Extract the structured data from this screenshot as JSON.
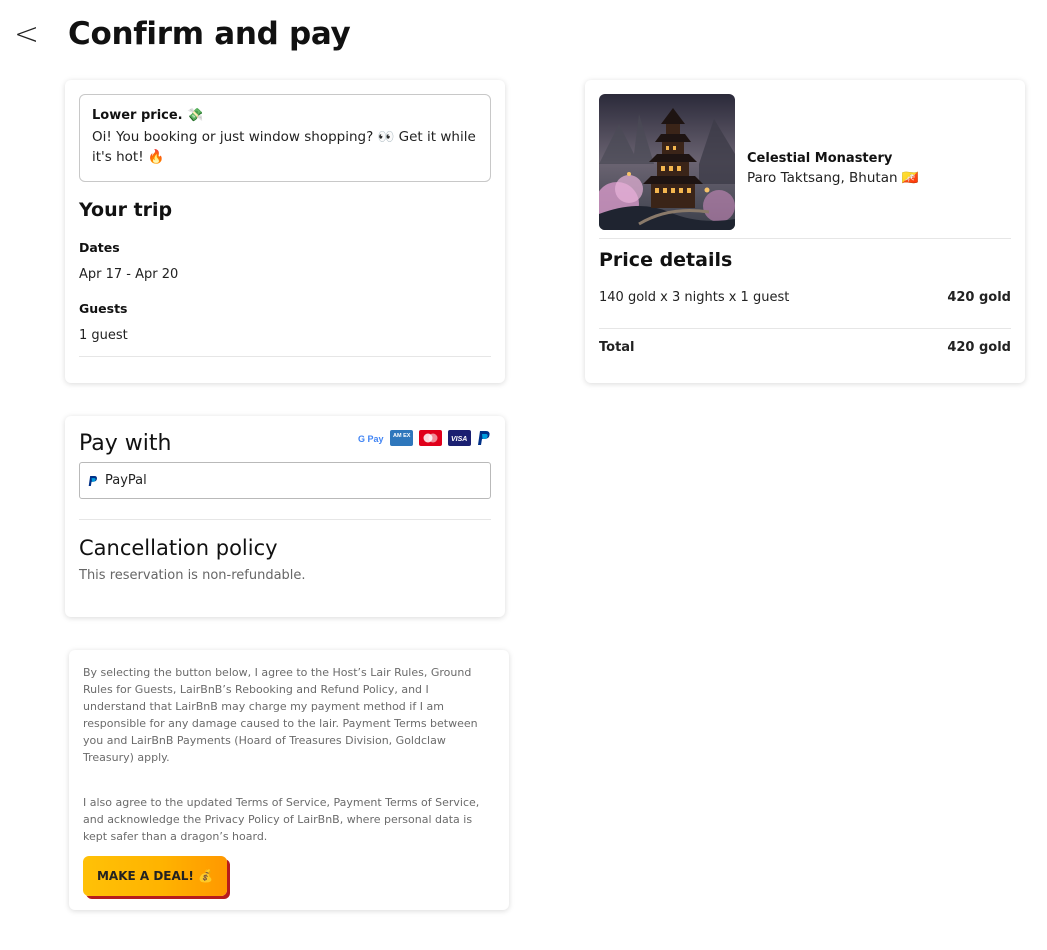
{
  "header": {
    "back_symbol": "<",
    "title": "Confirm and pay"
  },
  "promo": {
    "title": "Lower price. 💸",
    "text": "Oi! You booking or just window shopping? 👀 Get it while it's hot! 🔥"
  },
  "trip": {
    "heading": "Your trip",
    "dates_label": "Dates",
    "dates_value": "Apr 17 - Apr 20",
    "guests_label": "Guests",
    "guests_value": "1 guest"
  },
  "listing": {
    "name": "Celestial Monastery",
    "location": "Paro Taktsang, Bhutan 🇧🇹"
  },
  "price": {
    "heading": "Price details",
    "line_label": "140 gold x 3 nights x 1 guest",
    "line_amount": "420 gold",
    "total_label": "Total",
    "total_amount": "420 gold"
  },
  "payment": {
    "heading": "Pay with",
    "selected_method": "PayPal",
    "icons": [
      "google-pay-icon",
      "amex-icon",
      "mastercard-icon",
      "visa-icon",
      "paypal-icon"
    ],
    "gpay_text": "G Pay",
    "amex_text": "AM EX",
    "visa_text": "VISA"
  },
  "cancellation": {
    "heading": "Cancellation policy",
    "text": "This reservation is non-refundable."
  },
  "terms": {
    "paragraph1": "By selecting the button below, I agree to the Host’s Lair Rules, Ground Rules for Guests, LairBnB’s Rebooking and Refund Policy, and I understand that LairBnB may charge my payment method if I am responsible for any damage caused to the lair. Payment Terms between you and LairBnB Payments (Hoard of Treasures Division, Goldclaw Treasury) apply.",
    "paragraph2": "I also agree to the updated Terms of Service, Payment Terms of Service, and acknowledge the Privacy Policy of LairBnB, where personal data is kept safer than a dragon’s hoard.",
    "button_label": "MAKE A DEAL! 💰"
  },
  "colors": {
    "button_gradient_start": "#ffc107",
    "button_gradient_end": "#ff9800",
    "button_shadow": "#b71c1c",
    "amex_blue": "#2e77bc",
    "mastercard_red": "#eb001b",
    "visa_navy": "#1a1f71",
    "paypal_blue": "#003087"
  }
}
